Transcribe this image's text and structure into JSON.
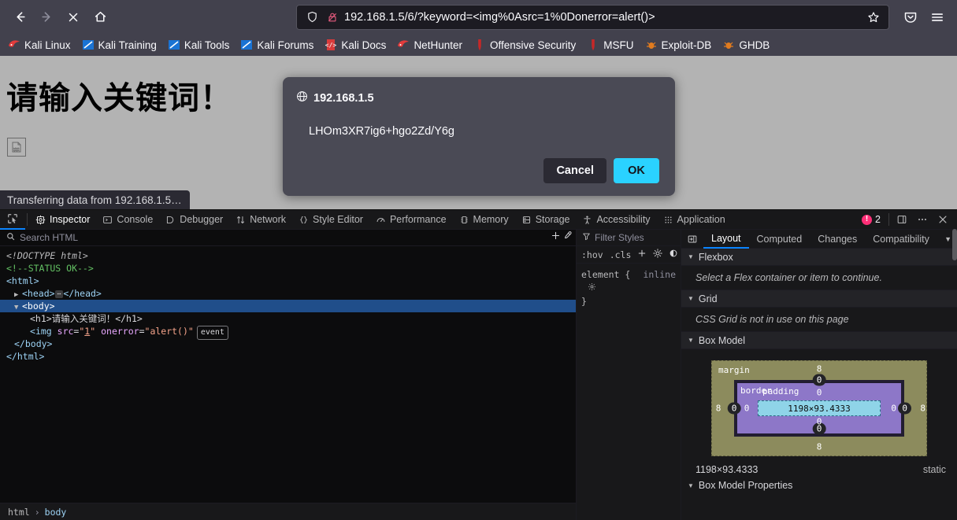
{
  "browser": {
    "nav": {
      "back": "back-arrow",
      "forward": "forward-arrow",
      "stop": "stop-x",
      "home": "home"
    },
    "url": {
      "host": "192.168.1.5",
      "path": "/6/?keyword=<img%0Asrc=1%0Donerror=alert()>",
      "full": "192.168.1.5/6/?keyword=<img%0Asrc=1%0Donerror=alert()>",
      "shield_icon": "tracking-protection-shield",
      "lock_icon": "insecure-connection-lock",
      "star_icon": "bookmark-star"
    },
    "toolbar_right": [
      {
        "name": "pocket-icon",
        "glyph": "pocket"
      },
      {
        "name": "app-menu-icon",
        "glyph": "hamburger"
      }
    ],
    "bookmarks": [
      {
        "label": "Kali Linux",
        "icon": "kali-dragon"
      },
      {
        "label": "Kali Training",
        "icon": "kali-blue"
      },
      {
        "label": "Kali Tools",
        "icon": "kali-blue"
      },
      {
        "label": "Kali Forums",
        "icon": "kali-blue"
      },
      {
        "label": "Kali Docs",
        "icon": "kali-docs-red"
      },
      {
        "label": "NetHunter",
        "icon": "kali-dragon"
      },
      {
        "label": "Offensive Security",
        "icon": "offsec-red"
      },
      {
        "label": "MSFU",
        "icon": "offsec-red"
      },
      {
        "label": "Exploit-DB",
        "icon": "exploit-db-orange"
      },
      {
        "label": "GHDB",
        "icon": "exploit-db-orange"
      }
    ]
  },
  "page": {
    "heading": "请输入关键词！",
    "broken_image_alt": "broken-image",
    "status_text": "Transferring data from 192.168.1.5…",
    "background": "#b3b3b3"
  },
  "dialog": {
    "origin": "192.168.1.5",
    "origin_icon": "globe-icon",
    "message": "LHOm3XR7ig6+hgo2Zd/Y6g",
    "cancel_label": "Cancel",
    "ok_label": "OK",
    "ok_color": "#2ad2ff"
  },
  "devtools": {
    "picker_icon": "element-picker-icon",
    "tabs": [
      {
        "label": "Inspector",
        "icon": "inspector-icon",
        "active": true
      },
      {
        "label": "Console",
        "icon": "console-icon",
        "active": false
      },
      {
        "label": "Debugger",
        "icon": "debugger-icon",
        "active": false
      },
      {
        "label": "Network",
        "icon": "network-icon",
        "active": false
      },
      {
        "label": "Style Editor",
        "icon": "style-editor-icon",
        "active": false
      },
      {
        "label": "Performance",
        "icon": "performance-icon",
        "active": false
      },
      {
        "label": "Memory",
        "icon": "memory-icon",
        "active": false
      },
      {
        "label": "Storage",
        "icon": "storage-icon",
        "active": false
      },
      {
        "label": "Accessibility",
        "icon": "accessibility-icon",
        "active": false
      },
      {
        "label": "Application",
        "icon": "application-icon",
        "active": false
      }
    ],
    "error_count": "2",
    "dock_icon": "dock-split-icon",
    "meatball_icon": "more-options-icon",
    "close_icon": "close-icon",
    "markup": {
      "search_placeholder": "Search HTML",
      "search_icon": "search-icon",
      "add_node_icon": "add-node-icon",
      "eyedropper_icon": "eyedropper-icon",
      "tree": [
        {
          "type": "doctype",
          "text": "<!DOCTYPE html>"
        },
        {
          "type": "comment",
          "text": "<!--STATUS OK-->"
        },
        {
          "type": "open",
          "text": "<html>"
        },
        {
          "type": "collapsed",
          "text": "<head>",
          "close": "</head>"
        },
        {
          "type": "selected",
          "text": "<body>"
        },
        {
          "type": "child-h1",
          "text": "<h1>请输入关键词！</h1>"
        },
        {
          "type": "child-img",
          "tag": "img",
          "attr1": "src",
          "val1": "1",
          "attr2": "onerror",
          "val2": "alert()",
          "badge": "event"
        },
        {
          "type": "close",
          "text": "</body>"
        },
        {
          "type": "close",
          "text": "</html>"
        }
      ],
      "breadcrumb": [
        "html",
        "body"
      ],
      "breadcrumb_separator": "›"
    },
    "rules": {
      "filter_placeholder": "Filter Styles",
      "filter_icon": "filter-icon",
      "hov_label": ":hov",
      "cls_label": ".cls",
      "add_rule_icon": "add-rule-icon",
      "light_scheme_icon": "light-color-scheme-icon",
      "dark_scheme_icon": "dark-color-scheme-icon",
      "selector": "element {",
      "source": "inline",
      "gear_icon": "gear-icon",
      "close_brace": "}"
    },
    "layout": {
      "pane_icon": "pane-toggle-icon",
      "tabs": [
        {
          "label": "Layout",
          "active": true
        },
        {
          "label": "Computed",
          "active": false
        },
        {
          "label": "Changes",
          "active": false
        },
        {
          "label": "Compatibility",
          "active": false
        }
      ],
      "overflow_icon": "chevron-down-icon",
      "flexbox": {
        "title": "Flexbox",
        "note": "Select a Flex container or item to continue."
      },
      "grid": {
        "title": "Grid",
        "note": "CSS Grid is not in use on this page"
      },
      "boxmodel": {
        "title": "Box Model",
        "margin_label": "margin",
        "border_label": "border",
        "padding_label": "padding",
        "content_size": "1198×93.4333",
        "margin": {
          "top": "8",
          "right": "8",
          "bottom": "8",
          "left": "8"
        },
        "border": {
          "top": "0",
          "right": "0",
          "bottom": "0",
          "left": "0"
        },
        "padding": {
          "top": "0",
          "right": "0",
          "bottom": "0",
          "left": "0"
        },
        "footer_size": "1198×93.4333",
        "footer_position": "static"
      },
      "boxmodel_properties_title": "Box Model Properties"
    }
  }
}
